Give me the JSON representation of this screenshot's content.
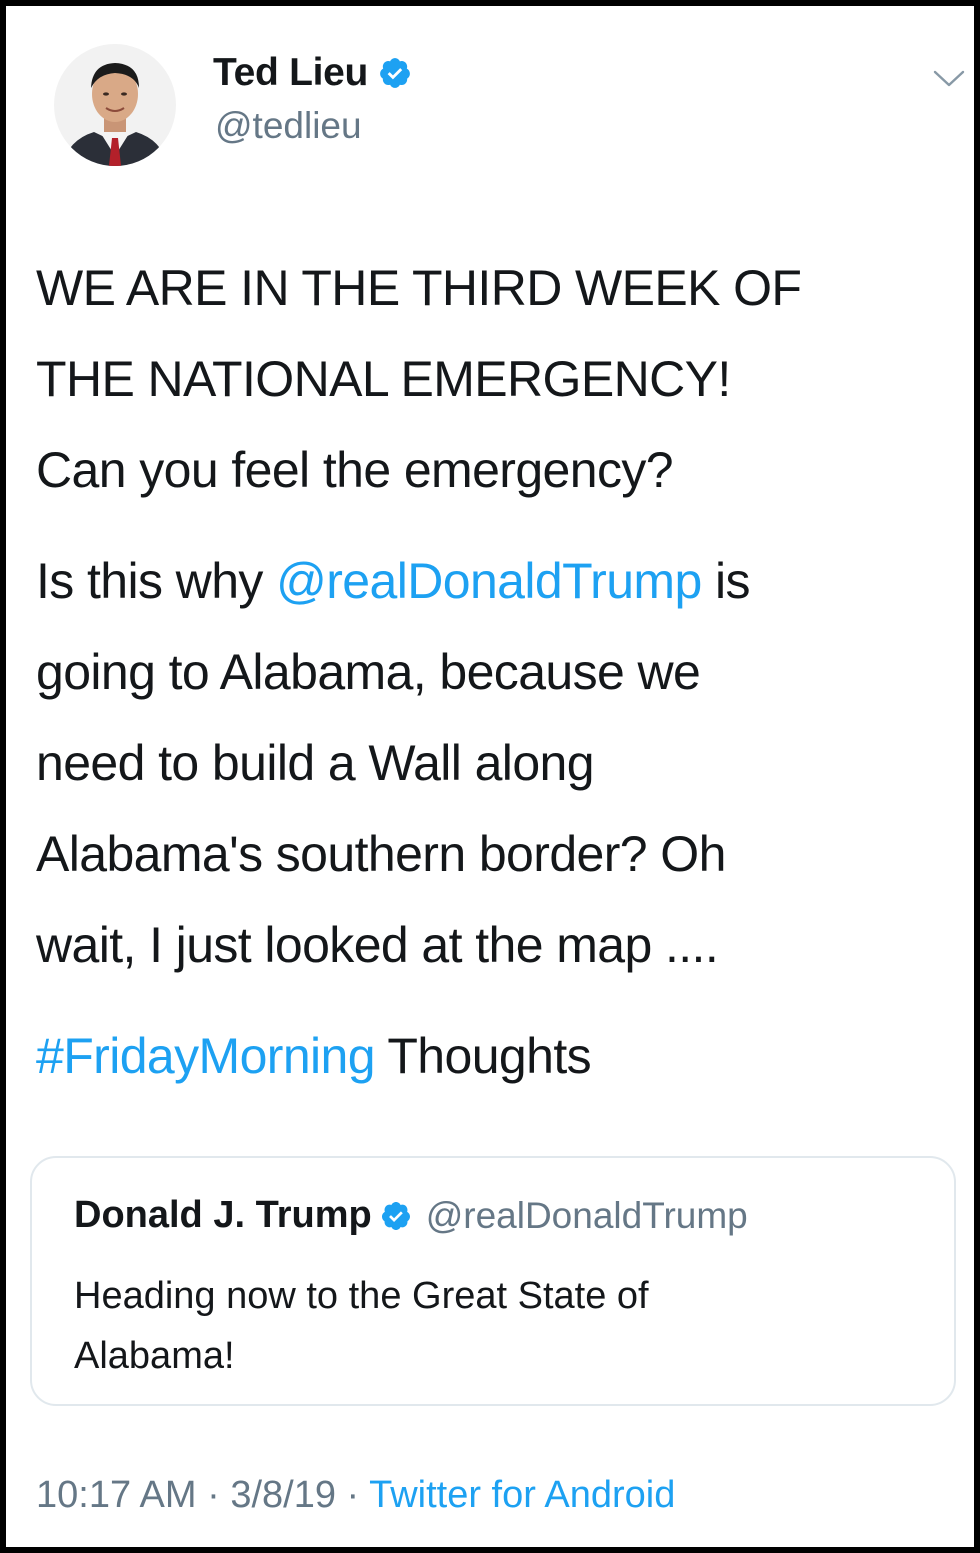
{
  "author": {
    "name": "Ted Lieu",
    "handle": "@tedlieu",
    "avatar_icon": "avatar-photo",
    "verified_icon": "verified-badge-icon"
  },
  "menu_icon": "chevron-down-icon",
  "tweet": {
    "line1": "WE ARE IN THE THIRD WEEK OF",
    "line2": "THE NATIONAL EMERGENCY!",
    "line3": "Can you feel the emergency?",
    "para2_prefix": "Is this why ",
    "para2_mention": "@realDonaldTrump",
    "para2_line1_suffix": " is",
    "para2_line2": "going to Alabama, because we",
    "para2_line3": "need to build a Wall along",
    "para2_line4": "Alabama's southern border? Oh",
    "para2_line5": "wait, I just looked at the map ....",
    "hashtag": "#FridayMorning",
    "hashtag_suffix": " Thoughts"
  },
  "quoted_tweet": {
    "name": "Donald J. Trump",
    "handle": "@realDonaldTrump",
    "text_line1": "Heading now to the Great State of",
    "text_line2": "Alabama!"
  },
  "footer": {
    "time": "10:17 AM",
    "sep1": " · ",
    "date": "3/8/19",
    "sep2": " · ",
    "source": "Twitter for Android"
  },
  "colors": {
    "link": "#1da1f2",
    "text": "#14171a",
    "muted": "#657786",
    "border": "#e1e8ed"
  }
}
